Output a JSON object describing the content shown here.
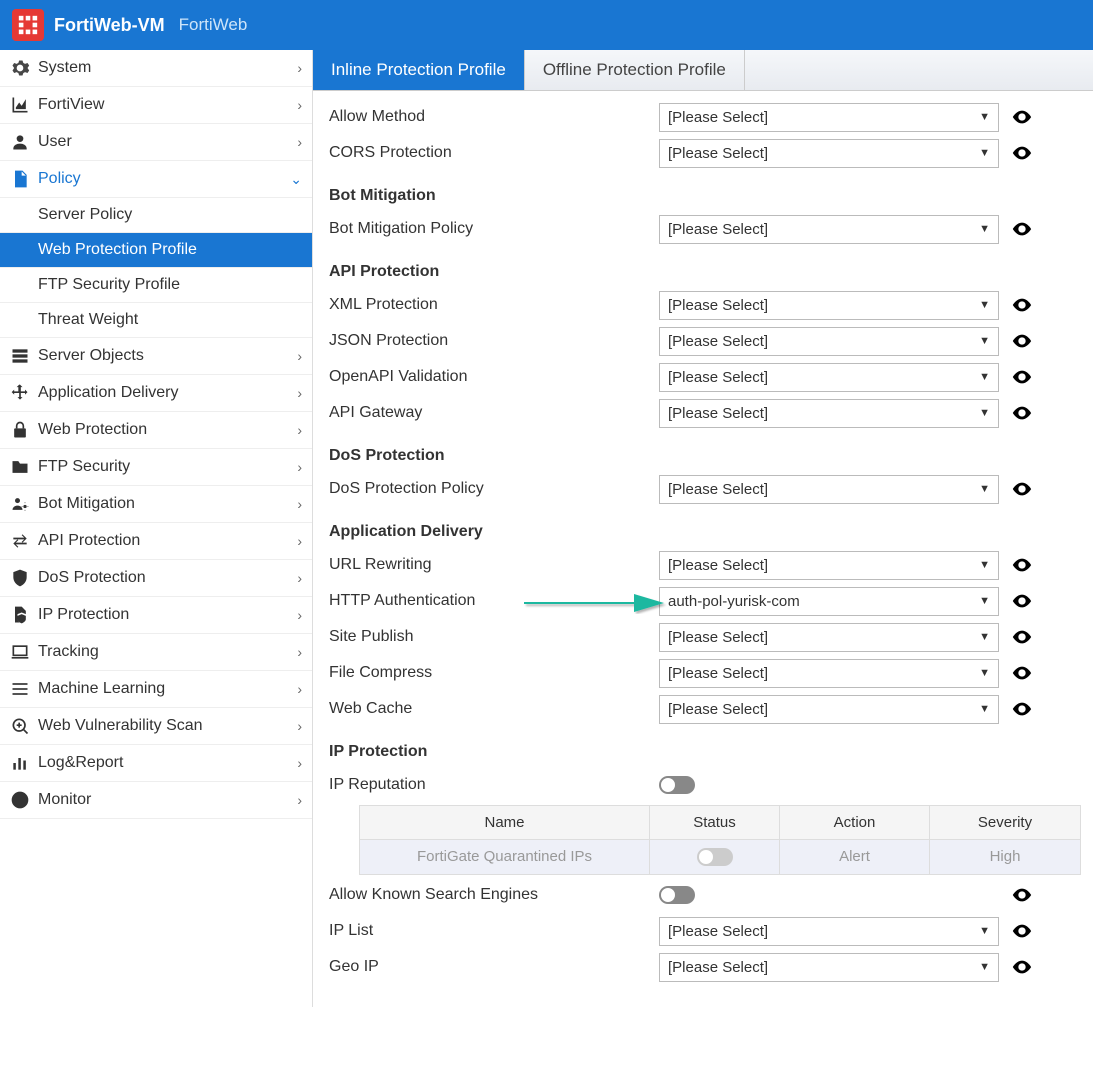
{
  "header": {
    "title": "FortiWeb-VM",
    "subtitle": "FortiWeb"
  },
  "sidebar": {
    "items": [
      {
        "label": "System",
        "icon": "gear",
        "chev": "›"
      },
      {
        "label": "FortiView",
        "icon": "chart-area",
        "chev": "›"
      },
      {
        "label": "User",
        "icon": "user",
        "chev": "›"
      },
      {
        "label": "Policy",
        "icon": "file",
        "chev": "⌄",
        "active": true,
        "sub": [
          {
            "label": "Server Policy"
          },
          {
            "label": "Web Protection Profile",
            "selected": true
          },
          {
            "label": "FTP Security Profile"
          },
          {
            "label": "Threat Weight"
          }
        ]
      },
      {
        "label": "Server Objects",
        "icon": "server",
        "chev": "›"
      },
      {
        "label": "Application Delivery",
        "icon": "move",
        "chev": "›"
      },
      {
        "label": "Web Protection",
        "icon": "lock",
        "chev": "›"
      },
      {
        "label": "FTP Security",
        "icon": "folder",
        "chev": "›"
      },
      {
        "label": "Bot Mitigation",
        "icon": "users-cog",
        "chev": "›"
      },
      {
        "label": "API Protection",
        "icon": "swap",
        "chev": "›"
      },
      {
        "label": "DoS Protection",
        "icon": "shield",
        "chev": "›"
      },
      {
        "label": "IP Protection",
        "icon": "file-shield",
        "chev": "›"
      },
      {
        "label": "Tracking",
        "icon": "laptop",
        "chev": "›"
      },
      {
        "label": "Machine Learning",
        "icon": "list",
        "chev": "›"
      },
      {
        "label": "Web Vulnerability Scan",
        "icon": "scan",
        "chev": "›"
      },
      {
        "label": "Log&Report",
        "icon": "bar",
        "chev": "›"
      },
      {
        "label": "Monitor",
        "icon": "pie",
        "chev": "›"
      }
    ]
  },
  "tabs": [
    {
      "label": "Inline Protection Profile",
      "active": true
    },
    {
      "label": "Offline Protection Profile",
      "active": false
    }
  ],
  "placeholder": "[Please Select]",
  "form": {
    "rows1": [
      {
        "label": "Allow Method",
        "value": "[Please Select]"
      },
      {
        "label": "CORS Protection",
        "value": "[Please Select]"
      }
    ],
    "sec_bot": "Bot Mitigation",
    "bot_row": {
      "label": "Bot Mitigation Policy",
      "value": "[Please Select]"
    },
    "sec_api": "API Protection",
    "api_rows": [
      {
        "label": "XML Protection",
        "value": "[Please Select]"
      },
      {
        "label": "JSON Protection",
        "value": "[Please Select]"
      },
      {
        "label": "OpenAPI Validation",
        "value": "[Please Select]"
      },
      {
        "label": "API Gateway",
        "value": "[Please Select]"
      }
    ],
    "sec_dos": "DoS Protection",
    "dos_row": {
      "label": "DoS Protection Policy",
      "value": "[Please Select]"
    },
    "sec_app": "Application Delivery",
    "app_rows": [
      {
        "label": "URL Rewriting",
        "value": "[Please Select]"
      },
      {
        "label": "HTTP Authentication",
        "value": "auth-pol-yurisk-com",
        "arrow": true
      },
      {
        "label": "Site Publish",
        "value": "[Please Select]"
      },
      {
        "label": "File Compress",
        "value": "[Please Select]"
      },
      {
        "label": "Web Cache",
        "value": "[Please Select]"
      }
    ],
    "sec_ip": "IP Protection",
    "ip_reputation_label": "IP Reputation",
    "ip_table": {
      "headers": {
        "name": "Name",
        "status": "Status",
        "action": "Action",
        "severity": "Severity"
      },
      "row": {
        "name": "FortiGate Quarantined IPs",
        "action": "Alert",
        "severity": "High"
      }
    },
    "allow_search_label": "Allow Known Search Engines",
    "ip_list_row": {
      "label": "IP List",
      "value": "[Please Select]"
    },
    "geo_ip_row": {
      "label": "Geo IP",
      "value": "[Please Select]"
    }
  }
}
